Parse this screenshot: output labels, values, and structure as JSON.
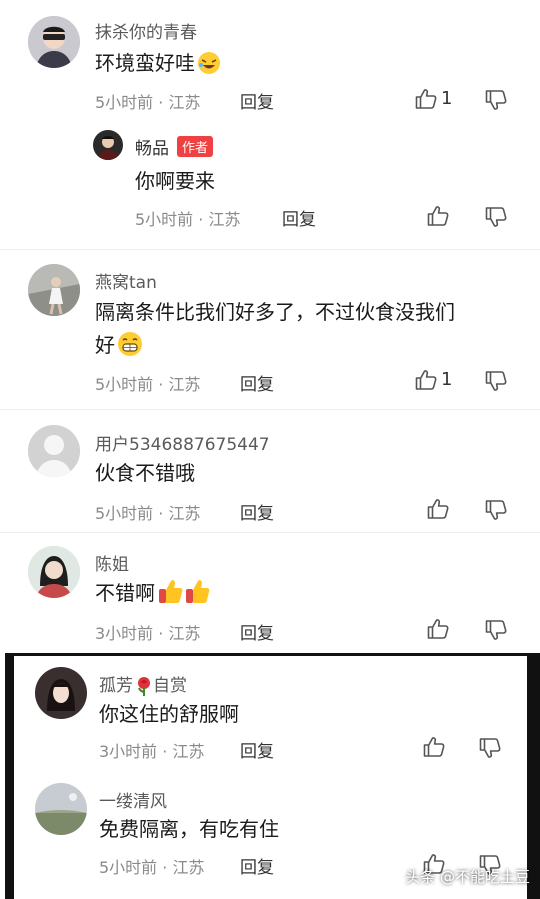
{
  "comments": [
    {
      "username": "抹杀你的青春",
      "text": "环境蛮好哇",
      "time_location": "5小时前 · 江苏",
      "reply_label": "回复",
      "like_count": "1"
    },
    {
      "username": "畅品",
      "badge": "作者",
      "text": "你啊要来",
      "time_location": "5小时前 · 江苏",
      "reply_label": "回复",
      "like_count": ""
    },
    {
      "username": "燕窝tan",
      "text_line1": "隔离条件比我们好多了，不过伙食没我们",
      "text_line2": "好",
      "time_location": "5小时前 · 江苏",
      "reply_label": "回复",
      "like_count": "1"
    },
    {
      "username": "用户5346887675447",
      "text": "伙食不错哦",
      "time_location": "5小时前 · 江苏",
      "reply_label": "回复",
      "like_count": ""
    },
    {
      "username": "陈姐",
      "text": "不错啊",
      "time_location": "3小时前 · 江苏",
      "reply_label": "回复",
      "like_count": ""
    },
    {
      "username": "孤芳",
      "username_suffix": "自赏",
      "text": "你这住的舒服啊",
      "time_location": "3小时前 · 江苏",
      "reply_label": "回复",
      "like_count": ""
    },
    {
      "username": "一缕清风",
      "text": "免费隔离，有吃有住",
      "time_location": "5小时前 · 江苏",
      "reply_label": "回复",
      "like_count": ""
    }
  ],
  "watermark": "头条 @不能吃土豆",
  "icons": {
    "like": "thumb-up-icon",
    "dislike": "thumb-down-icon",
    "laugh": "laughing-emoji-icon",
    "grin": "grin-emoji-icon",
    "thumbs": "thumbs-up-emoji-icon",
    "rose": "rose-emoji-icon"
  },
  "colors": {
    "author_badge": "#f04142",
    "meta": "#8a8a8a"
  }
}
